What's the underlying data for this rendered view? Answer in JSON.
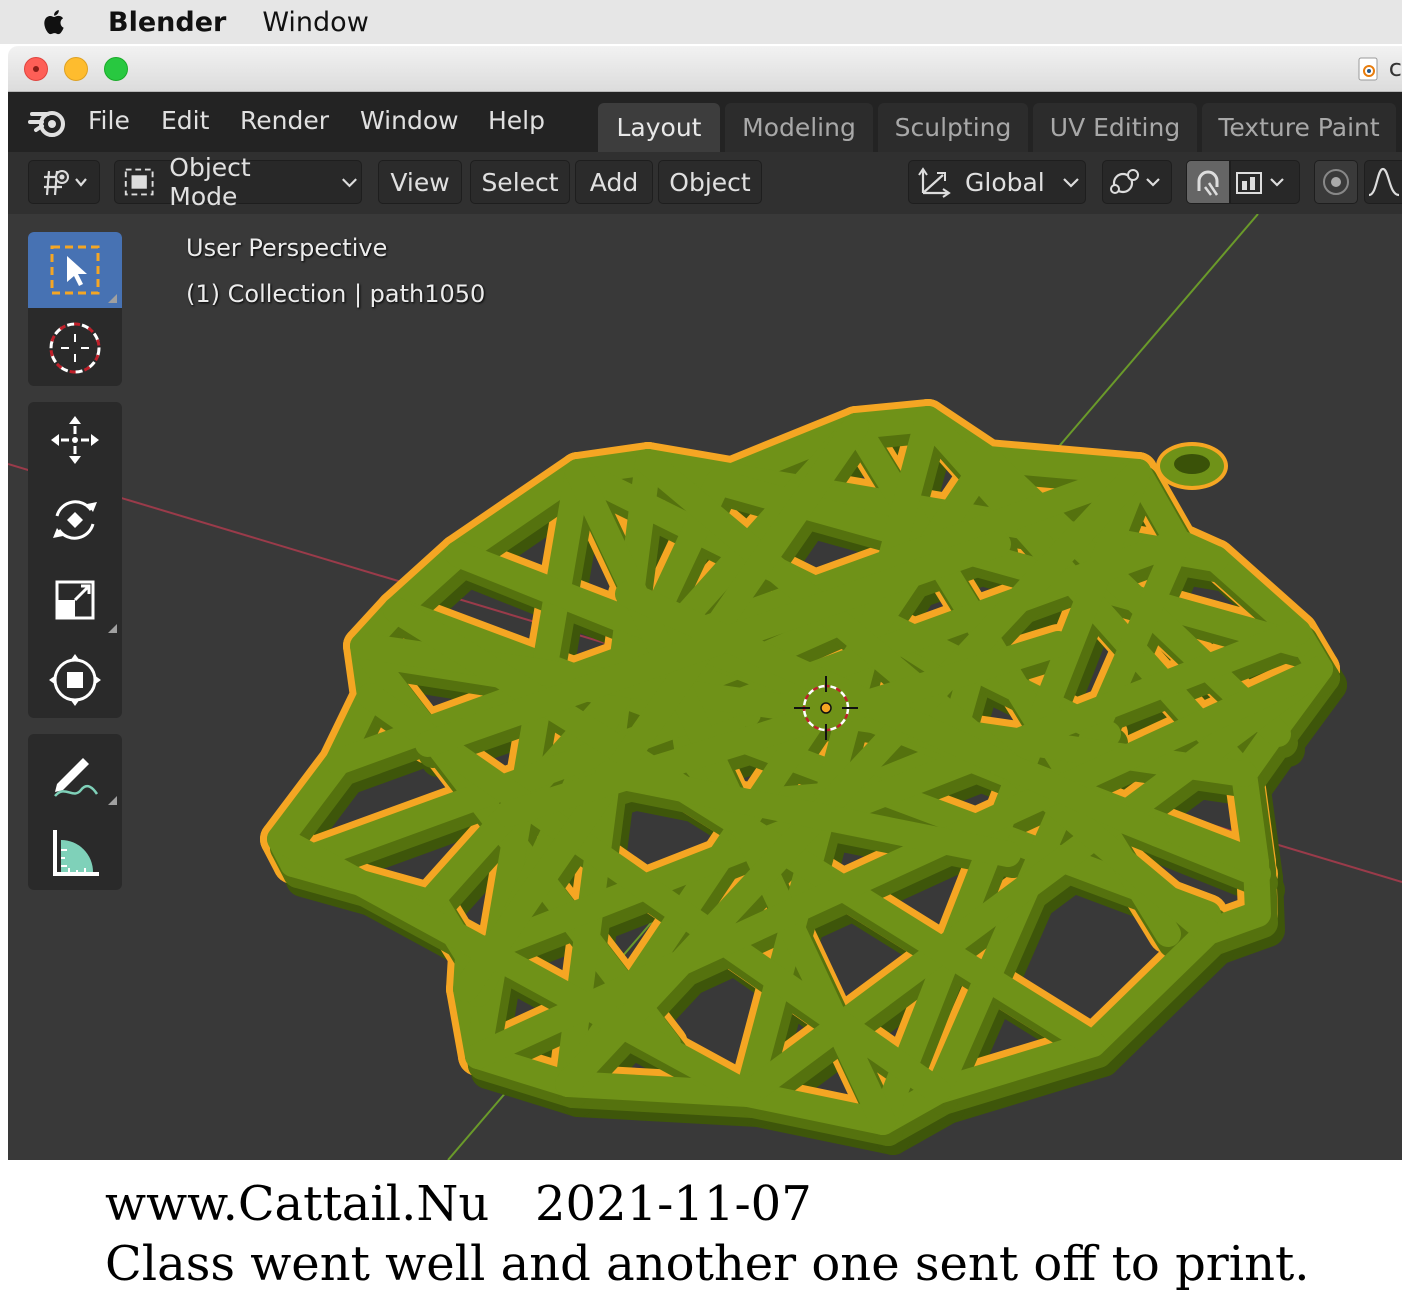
{
  "mac_menubar": {
    "app_name": "Blender",
    "window_menu": "Window",
    "apple_icon": "apple-logo-icon"
  },
  "window": {
    "title_initial": "c",
    "file_icon": "blender-file-icon"
  },
  "topbar": {
    "logo": "blender-logo-icon",
    "menus": [
      "File",
      "Edit",
      "Render",
      "Window",
      "Help"
    ],
    "workspaces": [
      {
        "label": "Layout",
        "active": true
      },
      {
        "label": "Modeling",
        "active": false
      },
      {
        "label": "Sculpting",
        "active": false
      },
      {
        "label": "UV Editing",
        "active": false
      },
      {
        "label": "Texture Paint",
        "active": false
      }
    ]
  },
  "header": {
    "editor_type_icon": "view3d-editor-icon",
    "mode": "Object Mode",
    "menus": [
      "View",
      "Select",
      "Add",
      "Object"
    ],
    "transform_orientation": "Global",
    "pivot_icon": "pivot-point-icon",
    "snap_icon": "snap-magnet-icon",
    "snap_target_icon": "snap-target-icon",
    "proportional_icon": "proportional-edit-icon",
    "falloff_icon": "falloff-curve-icon"
  },
  "viewport": {
    "perspective": "User Perspective",
    "collection_info": "(1) Collection | path1050",
    "colors": {
      "background": "#393939",
      "object": "#6b8e14",
      "object_side": "#4f6b0d",
      "outline": "#f5a623",
      "x_axis": "#9a3b4a",
      "y_axis": "#6a9a2a"
    }
  },
  "toolbar": {
    "tools": [
      "select-box-tool-icon",
      "cursor-tool-icon",
      "move-tool-icon",
      "rotate-tool-icon",
      "scale-tool-icon",
      "transform-tool-icon",
      "annotate-tool-icon",
      "measure-tool-icon"
    ]
  },
  "caption": {
    "line1": "www.Cattail.Nu   2021-11-07",
    "line2": "Class went well and another one sent off to print."
  }
}
